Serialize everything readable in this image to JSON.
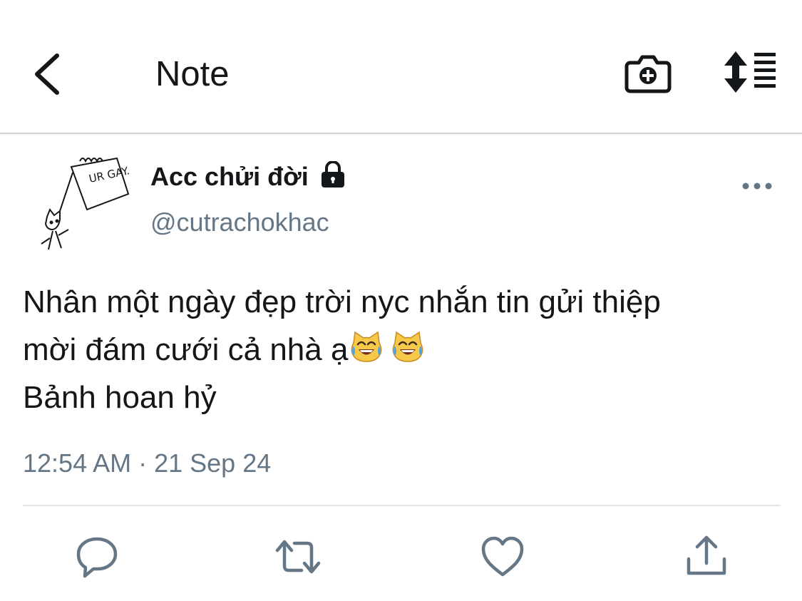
{
  "header": {
    "title": "Note",
    "icons": {
      "back": "chevron-left-icon",
      "camera": "camera-plus-icon",
      "sort": "sort-list-icon"
    }
  },
  "tweet": {
    "author": {
      "display_name": "Acc chửi đời",
      "handle": "@cutrachokhac",
      "protected_icon": "lock-icon",
      "avatar_text": "UR GAY."
    },
    "text_lines": [
      "Nhân một ngày đẹp trời nyc nhắn tin gửi thiệp",
      "mời đám cưới cả nhà ạ",
      "Bảnh hoan hỷ"
    ],
    "emojis": [
      "cat-with-tears-of-joy-emoji",
      "cat-with-tears-of-joy-emoji"
    ],
    "timestamp": "12:54 AM · 21 Sep 24"
  },
  "actions": {
    "reply": "reply-icon",
    "retweet": "retweet-icon",
    "like": "heart-icon",
    "share": "share-icon"
  },
  "colors": {
    "text": "#14171a",
    "secondary": "#657786",
    "divider": "#e1e4e8",
    "emoji_yellow": "#f7c94b"
  }
}
